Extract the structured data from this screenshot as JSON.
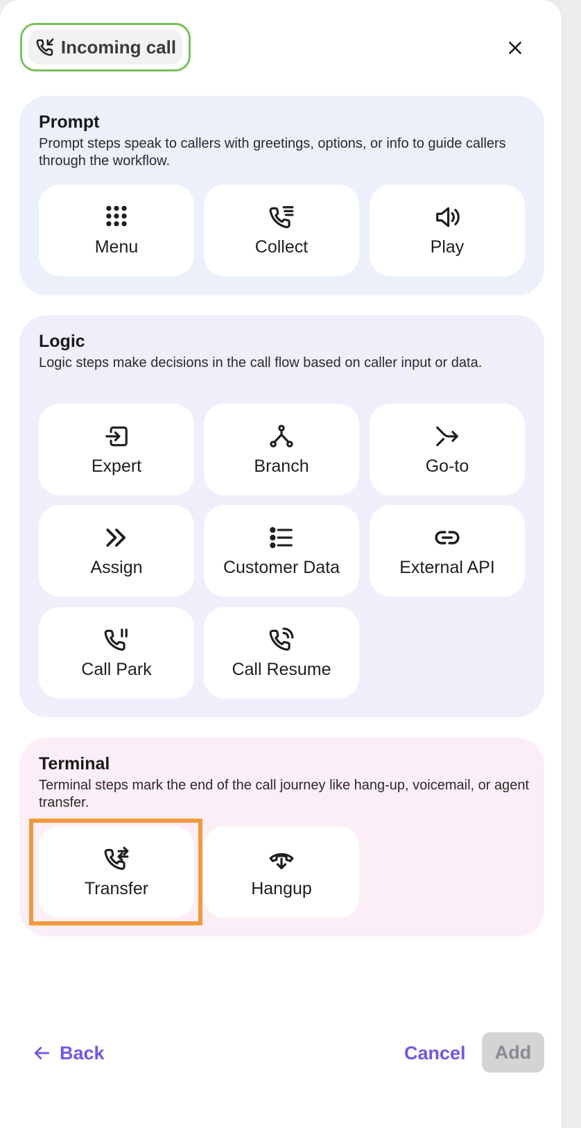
{
  "header": {
    "trigger_label": "Incoming call",
    "trigger_icon": "phone-incoming-icon",
    "close_icon": "close-icon"
  },
  "sections": [
    {
      "title": "Prompt",
      "description": "Prompt steps speak to callers with greetings, options, or info to guide callers through the workflow.",
      "items": [
        {
          "label": "Menu",
          "icon": "keypad-grid-icon"
        },
        {
          "label": "Collect",
          "icon": "phone-list-icon"
        },
        {
          "label": "Play",
          "icon": "speaker-icon"
        }
      ]
    },
    {
      "title": "Logic",
      "description": "Logic steps make decisions in the call flow based on caller input or data.",
      "items": [
        {
          "label": "Expert",
          "icon": "enter-box-icon"
        },
        {
          "label": "Branch",
          "icon": "branch-icon"
        },
        {
          "label": "Go-to",
          "icon": "redirect-arrow-icon"
        },
        {
          "label": "Assign",
          "icon": "double-chevron-right-icon"
        },
        {
          "label": "Customer Data",
          "icon": "list-icon"
        },
        {
          "label": "External API",
          "icon": "link-icon"
        },
        {
          "label": "Call Park",
          "icon": "phone-pause-icon"
        },
        {
          "label": "Call Resume",
          "icon": "phone-ringing-icon"
        }
      ]
    },
    {
      "title": "Terminal",
      "description": "Terminal steps mark the end of the call journey like hang-up, voicemail, or agent transfer.",
      "items": [
        {
          "label": "Transfer",
          "icon": "phone-transfer-icon",
          "selected": true
        },
        {
          "label": "Hangup",
          "icon": "phone-hangup-icon"
        }
      ]
    }
  ],
  "footer": {
    "back_label": "Back",
    "cancel_label": "Cancel",
    "add_label": "Add",
    "add_enabled": false
  },
  "colors": {
    "accent": "#6f56e8",
    "trigger_border": "#78c25a",
    "selection_outline": "#f09a3e",
    "prompt_bg": "#ebf0fa",
    "logic_bg": "#f1eefc",
    "terminal_bg": "#fbeef6"
  }
}
